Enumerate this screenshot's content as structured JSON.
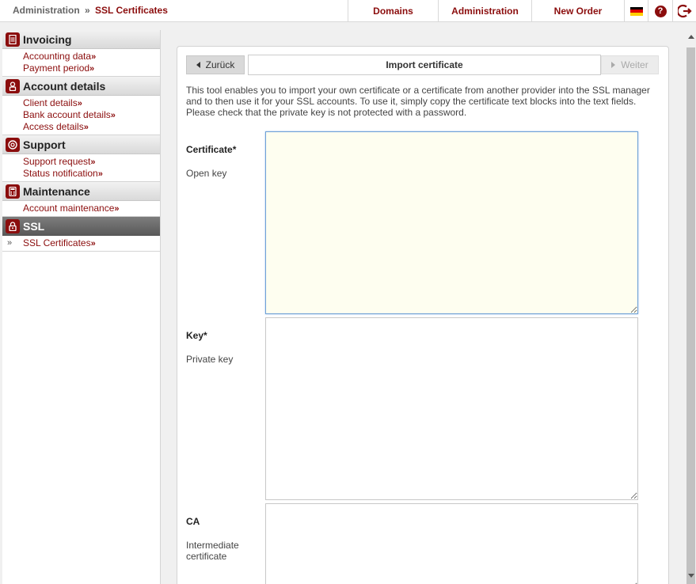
{
  "breadcrumb": {
    "root": "Administration",
    "separator": "»",
    "current": "SSL Certificates"
  },
  "topnav": {
    "domains": "Domains",
    "administration": "Administration",
    "new_order": "New Order",
    "help": "?"
  },
  "sidebar": {
    "sections": [
      {
        "title": "Invoicing",
        "icon": "document-icon",
        "items": [
          "Accounting data",
          "Payment period"
        ]
      },
      {
        "title": "Account details",
        "icon": "user-icon",
        "items": [
          "Client details",
          "Bank account details",
          "Access details"
        ]
      },
      {
        "title": "Support",
        "icon": "lifebuoy-icon",
        "items": [
          "Support request",
          "Status notification"
        ]
      },
      {
        "title": "Maintenance",
        "icon": "calculator-icon",
        "items": [
          "Account maintenance"
        ]
      },
      {
        "title": "SSL",
        "icon": "lock-icon",
        "items": [
          "SSL Certificates"
        ],
        "active": true
      }
    ],
    "arrow": "»",
    "bullet": "»"
  },
  "wizard": {
    "back_label": "Zurück",
    "title": "Import certificate",
    "next_label": "Weiter",
    "description": "This tool enables you to import your own certificate or a certificate from another provider into the SSL manager and to then use it for your SSL accounts. To use it, simply copy the certificate text blocks into the text fields. Please check that the private key is not protected with a password."
  },
  "fields": {
    "certificate": {
      "label": "Certificate*",
      "sub": "Open key",
      "value": ""
    },
    "key": {
      "label": "Key*",
      "sub": "Private key",
      "value": ""
    },
    "ca": {
      "label": "CA",
      "sub": "Intermediate certificate",
      "value": ""
    }
  },
  "colors": {
    "brand": "#8b0d0d",
    "focus_bg": "#fefef0",
    "focus_border": "#6ea0d6"
  }
}
